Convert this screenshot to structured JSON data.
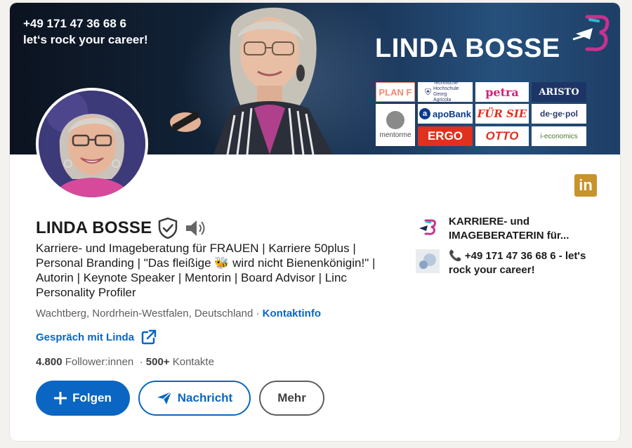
{
  "banner": {
    "phone": "+49 171 47 36 68 6",
    "tagline": "let‘s rock your career!",
    "name": "LINDA BOSSE",
    "clients": [
      {
        "label": "PLAN F",
        "color": "#f28b6e"
      },
      {
        "label": "Technische Hochschule Georg Agricola",
        "color": "#2b3a6b"
      },
      {
        "label": "petra",
        "color": "#d0237b"
      },
      {
        "label": "ARISTO",
        "color": "#ffffff"
      },
      {
        "label": "mentorme",
        "color": "#4a4a4a"
      },
      {
        "label": "apoBank",
        "color": "#0b3b8c"
      },
      {
        "label": "FÜR SIE",
        "color": "#e0301e"
      },
      {
        "label": "de·ge·pol",
        "color": "#2b3a6b"
      },
      {
        "label": "ERGO",
        "color": "#ffffff"
      },
      {
        "label": "OTTO",
        "color": "#e0301e"
      },
      {
        "label": "i-economics",
        "color": "#4a7a2b"
      }
    ]
  },
  "profile": {
    "name": "LINDA BOSSE",
    "headline": "Karriere- und Imageberatung für FRAUEN | Karriere 50plus | Personal Branding | \"Das fleißige 🐝 wird nicht Bienenkönigin!\" | Autorin | Keynote Speaker | Mentorin | Board Advisor | Linc Personality Profiler",
    "location": "Wachtberg, Nordrhein-Westfalen, Deutschland",
    "separator": " · ",
    "contact_info": "Kontaktinfo",
    "conversation": "Gespräch mit Linda",
    "followers": "4.800",
    "followers_label": " Follower:innen",
    "stats_sep": "  · ",
    "connections": "500+",
    "connections_label": " Kontakte"
  },
  "actions": {
    "follow": "Folgen",
    "message": "Nachricht",
    "more": "Mehr"
  },
  "side": {
    "company": "KARRIERE- und IMAGEBERATERIN für...",
    "website": "📞 +49 171 47 36 68 6 - let's rock your career!"
  },
  "colors": {
    "linkedin_blue": "#0a66c2",
    "badge_gold": "#c8922c"
  }
}
